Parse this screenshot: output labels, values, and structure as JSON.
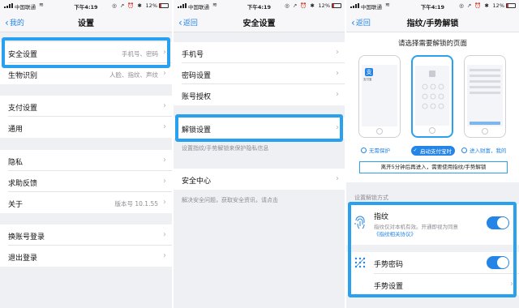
{
  "status_bar": {
    "carrier": "中国联通",
    "wifi_icon": "wifi-icon",
    "time": "下午4:19",
    "icons": "◎ ↗ ⏰ ✱",
    "battery": "12%"
  },
  "panel1": {
    "nav": {
      "back_label": "我的",
      "title": "设置"
    },
    "items": [
      {
        "label": "安全设置",
        "value": "手机号、密码"
      },
      {
        "label": "生物识别",
        "value": "人脸、指纹、声纹"
      },
      {
        "label": "支付设置",
        "value": ""
      },
      {
        "label": "通用",
        "value": ""
      },
      {
        "label": "隐私",
        "value": ""
      },
      {
        "label": "求助反馈",
        "value": ""
      },
      {
        "label": "关于",
        "value": "版本号 10.1.55"
      },
      {
        "label": "换账号登录",
        "value": ""
      },
      {
        "label": "退出登录",
        "value": ""
      }
    ]
  },
  "panel2": {
    "nav": {
      "back_label": "返回",
      "title": "安全设置"
    },
    "items": [
      {
        "label": "手机号"
      },
      {
        "label": "密码设置"
      },
      {
        "label": "账号授权"
      },
      {
        "label": "解锁设置"
      },
      {
        "label": "安全中心"
      }
    ],
    "hint_unlock": "设置指纹/手势解锁来保护隐私信息",
    "hint_security": "解决安全问题，获取安全资讯，请点击"
  },
  "panel3": {
    "nav": {
      "back_label": "返回",
      "title": "指纹/手势解锁"
    },
    "heading": "请选择需要解锁的页面",
    "alipay_logo_text": "支付宝",
    "options": [
      {
        "label": "无需保护",
        "selected": false
      },
      {
        "label": "启动支付宝时",
        "selected": true
      },
      {
        "label": "进入财富，我的",
        "selected": false
      }
    ],
    "notice": "离开5分钟后再进入，需要使用指纹/手势解锁",
    "section_label": "设置解锁方式",
    "fingerprint": {
      "title": "指纹",
      "desc": "指纹仅对本机有效。开通即视为同意",
      "link": "《指纹相关协议》",
      "enabled": true,
      "icon": "fingerprint-icon"
    },
    "gesture": {
      "title": "手势密码",
      "enabled": true,
      "icon": "gesture-icon"
    },
    "gesture_settings": {
      "label": "手势设置"
    }
  },
  "colors": {
    "accent": "#2585e6",
    "highlight": "#2aa1ee",
    "background": "#eff0f4",
    "secondary_text": "#8d8d93"
  }
}
